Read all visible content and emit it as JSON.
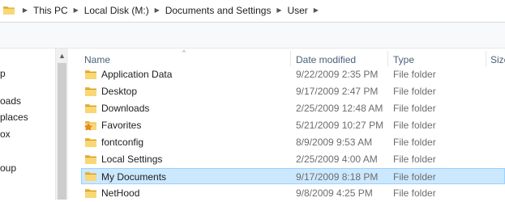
{
  "breadcrumb": {
    "items": [
      "This PC",
      "Local Disk (M:)",
      "Documents and Settings",
      "User"
    ],
    "separator_glyph": "▶"
  },
  "nav": {
    "up_glyph": "▲",
    "items": [
      "p",
      "oads",
      " places",
      "ox",
      "oup"
    ]
  },
  "columns": {
    "name": "Name",
    "date_modified": "Date modified",
    "type": "Type",
    "size": "Size",
    "sort_glyph": "^"
  },
  "rows": [
    {
      "name": "Application Data",
      "date": "9/22/2009 2:35 PM",
      "type": "File folder",
      "icon": "folder-icon",
      "selected": false
    },
    {
      "name": "Desktop",
      "date": "9/17/2009 2:47 PM",
      "type": "File folder",
      "icon": "folder-icon",
      "selected": false
    },
    {
      "name": "Downloads",
      "date": "2/25/2009 12:48 AM",
      "type": "File folder",
      "icon": "folder-icon",
      "selected": false
    },
    {
      "name": "Favorites",
      "date": "5/21/2009 10:27 PM",
      "type": "File folder",
      "icon": "favorites-folder-icon",
      "selected": false
    },
    {
      "name": "fontconfig",
      "date": "8/9/2009 9:53 AM",
      "type": "File folder",
      "icon": "folder-icon",
      "selected": false
    },
    {
      "name": "Local Settings",
      "date": "2/25/2009 4:00 AM",
      "type": "File folder",
      "icon": "folder-icon",
      "selected": false
    },
    {
      "name": "My Documents",
      "date": "9/17/2009 8:18 PM",
      "type": "File folder",
      "icon": "folder-icon",
      "selected": true
    },
    {
      "name": "NetHood",
      "date": "9/8/2009 4:25 PM",
      "type": "File folder",
      "icon": "folder-icon",
      "selected": false
    }
  ],
  "colors": {
    "selection_bg": "#cce8ff",
    "selection_border": "#99d1ff",
    "header_text": "#4c607a",
    "folder_yellow": "#f5c94a"
  }
}
